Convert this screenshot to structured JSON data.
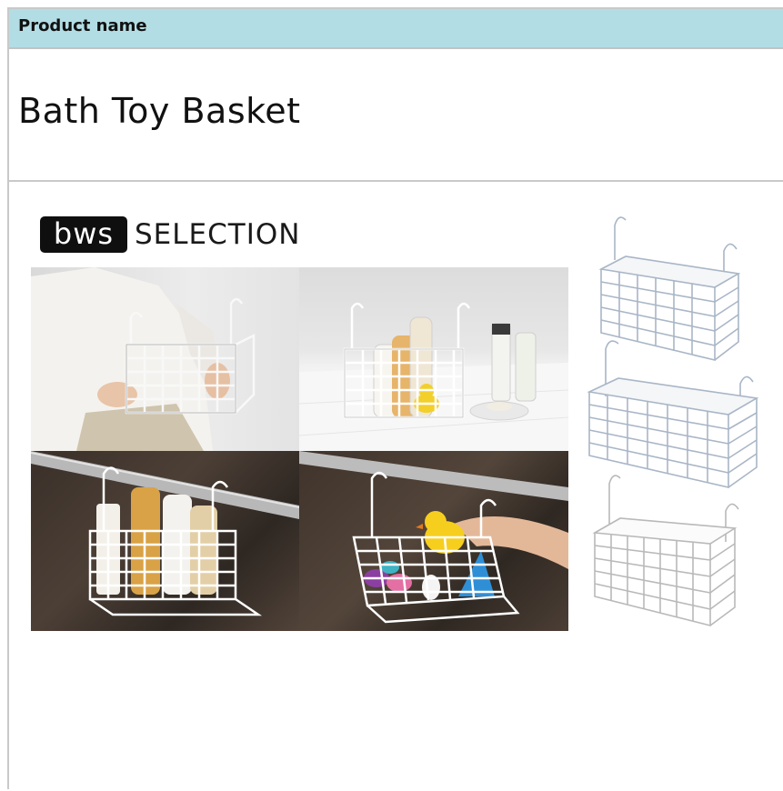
{
  "header": {
    "label": "Product name"
  },
  "product": {
    "name": "Bath Toy Basket"
  },
  "brand": {
    "logo_text": "bws",
    "selection_text": "SELECTION"
  },
  "colors": {
    "header_bg": "#b3dde5",
    "border": "#c9c9c9",
    "basket_white": "#f4f6f8",
    "basket_silver": "#c8c8c8"
  }
}
